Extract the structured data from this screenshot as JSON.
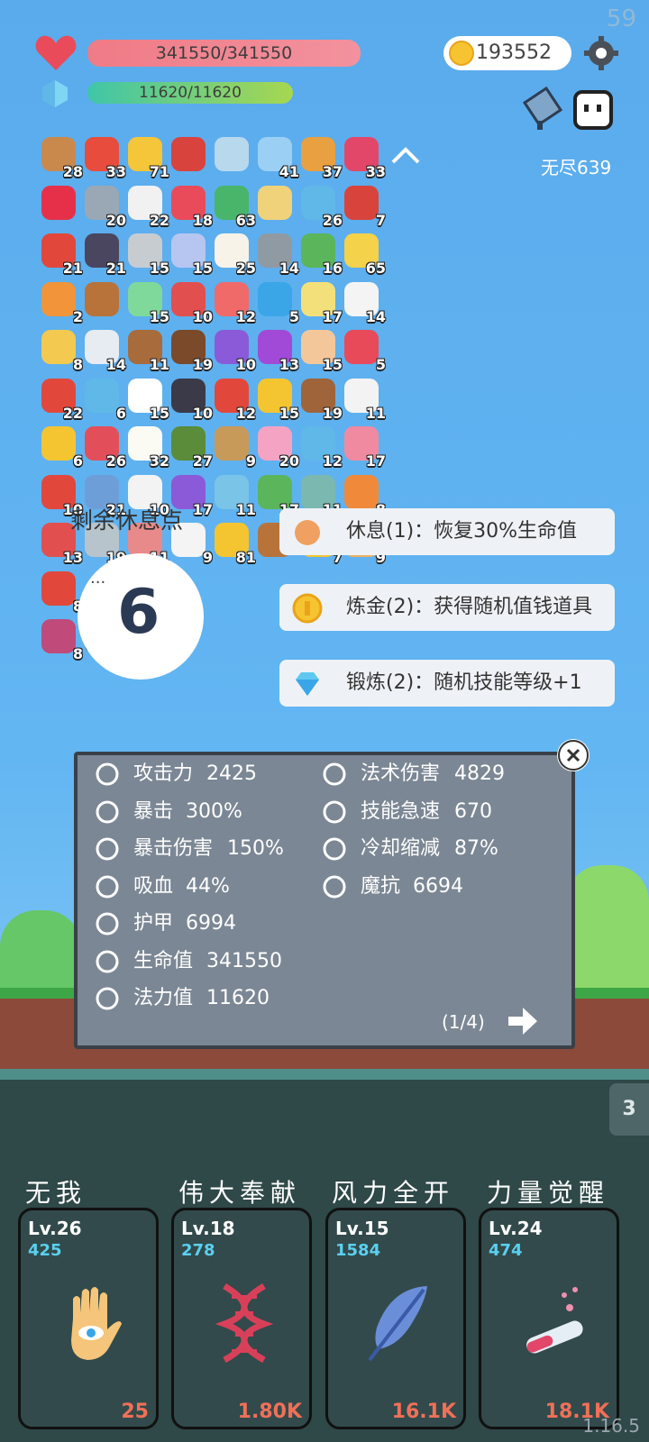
{
  "hud": {
    "fps": "59",
    "hp_text": "341550/341550",
    "mp_text": "11620/11620",
    "coins": "193552",
    "endless_label": "无尽639",
    "version": "1.16.5"
  },
  "items": [
    {
      "icon": "shield-wood-icon",
      "count": "28",
      "color": "#c9894d"
    },
    {
      "icon": "sock-icon",
      "count": "33",
      "color": "#e74c3c"
    },
    {
      "icon": "crown-icon",
      "count": "71",
      "color": "#f5c53a"
    },
    {
      "icon": "magnet-icon",
      "count": "",
      "color": "#d9433d"
    },
    {
      "icon": "magnifier-icon",
      "count": "",
      "color": "#b8d8ee"
    },
    {
      "icon": "star-card-icon",
      "count": "41",
      "color": "#9bd0f4"
    },
    {
      "icon": "book-icon",
      "count": "37",
      "color": "#e8a040"
    },
    {
      "icon": "jam-jar-icon",
      "count": "33",
      "color": "#e2476a"
    },
    {
      "icon": "ruby-icon",
      "count": "",
      "color": "#e6304a"
    },
    {
      "icon": "elephant-icon",
      "count": "20",
      "color": "#9aa8b5"
    },
    {
      "icon": "clipboard-icon",
      "count": "22",
      "color": "#f1f1f1"
    },
    {
      "icon": "heart-icon",
      "count": "18",
      "color": "#e94b5a"
    },
    {
      "icon": "money-icon",
      "count": "63",
      "color": "#48b56a"
    },
    {
      "icon": "map-icon",
      "count": "",
      "color": "#f0d27a"
    },
    {
      "icon": "planet-icon",
      "count": "26",
      "color": "#5fb8e8"
    },
    {
      "icon": "red-shield-icon",
      "count": "7",
      "color": "#d8443c"
    },
    {
      "icon": "mushroom-icon",
      "count": "21",
      "color": "#e2473b"
    },
    {
      "icon": "bat-icon",
      "count": "21",
      "color": "#4a4660"
    },
    {
      "icon": "compass-icon",
      "count": "15",
      "color": "#c7ccd1"
    },
    {
      "icon": "pill-icon",
      "count": "15",
      "color": "#b7c6f0"
    },
    {
      "icon": "egg-icon",
      "count": "25",
      "color": "#f7f3e8"
    },
    {
      "icon": "spiked-ball-icon",
      "count": "14",
      "color": "#8f9aa3"
    },
    {
      "icon": "helmet-icon",
      "count": "16",
      "color": "#5bb55a"
    },
    {
      "icon": "bulb-icon",
      "count": "65",
      "color": "#f4d24a"
    },
    {
      "icon": "torch-icon",
      "count": "2",
      "color": "#f1943a"
    },
    {
      "icon": "chest-icon",
      "count": "",
      "color": "#b7733a"
    },
    {
      "icon": "ghost-green-icon",
      "count": "15",
      "color": "#7fd99a"
    },
    {
      "icon": "potion-icon",
      "count": "10",
      "color": "#e24f4f"
    },
    {
      "icon": "capsule-icon",
      "count": "12",
      "color": "#f06a6a"
    },
    {
      "icon": "sapphire-icon",
      "count": "5",
      "color": "#3aa6e8"
    },
    {
      "icon": "halo-icon",
      "count": "17",
      "color": "#f4e07a"
    },
    {
      "icon": "dice-icon",
      "count": "14",
      "color": "#f4f4f4"
    },
    {
      "icon": "scroll-icon",
      "count": "8",
      "color": "#f3c94f"
    },
    {
      "icon": "envelope-icon",
      "count": "14",
      "color": "#e6ecf2"
    },
    {
      "icon": "flag-icon",
      "count": "11",
      "color": "#a86b3c"
    },
    {
      "icon": "coconut-icon",
      "count": "19",
      "color": "#7a4a2a"
    },
    {
      "icon": "purple-box-icon",
      "count": "10",
      "color": "#8a5ad8"
    },
    {
      "icon": "crystal-ball-icon",
      "count": "13",
      "color": "#a24ad8"
    },
    {
      "icon": "hand-icon",
      "count": "15",
      "color": "#f4c79a"
    },
    {
      "icon": "hearts-icon",
      "count": "5",
      "color": "#e84a5a"
    },
    {
      "icon": "apple-icon",
      "count": "22",
      "color": "#e2473b"
    },
    {
      "icon": "target-icon",
      "count": "6",
      "color": "#5fb8e8"
    },
    {
      "icon": "ghost-icon",
      "count": "15",
      "color": "#ffffff"
    },
    {
      "icon": "cauldron-icon",
      "count": "10",
      "color": "#3a3a48"
    },
    {
      "icon": "strawberry-icon",
      "count": "12",
      "color": "#e2473b"
    },
    {
      "icon": "sunflower-icon",
      "count": "15",
      "color": "#f4c531"
    },
    {
      "icon": "door-icon",
      "count": "19",
      "color": "#a0643a"
    },
    {
      "icon": "cards-icon",
      "count": "11",
      "color": "#f3f3f3"
    },
    {
      "icon": "ring-icon",
      "count": "6",
      "color": "#f4c531"
    },
    {
      "icon": "watermelon-icon",
      "count": "26",
      "color": "#e24f5a"
    },
    {
      "icon": "fried-egg-icon",
      "count": "32",
      "color": "#fbfbf4"
    },
    {
      "icon": "grenade-icon",
      "count": "27",
      "color": "#5a8c3a"
    },
    {
      "icon": "noose-icon",
      "count": "9",
      "color": "#c89a5a"
    },
    {
      "icon": "icecream-icon",
      "count": "20",
      "color": "#f4a3c3"
    },
    {
      "icon": "chat-bubble-icon",
      "count": "12",
      "color": "#5fb8e8"
    },
    {
      "icon": "spray-bottle-icon",
      "count": "17",
      "color": "#f08aa0"
    },
    {
      "icon": "gift-icon",
      "count": "10",
      "color": "#e2473b"
    },
    {
      "icon": "blue-shield-icon",
      "count": "21",
      "color": "#6e9ed8"
    },
    {
      "icon": "half-moon-icon",
      "count": "10",
      "color": "#f3f3f3"
    },
    {
      "icon": "purple-shield-icon",
      "count": "17",
      "color": "#8a5ad8"
    },
    {
      "icon": "blueprint-icon",
      "count": "11",
      "color": "#7ac4e8"
    },
    {
      "icon": "monster-icon",
      "count": "17",
      "color": "#5bb55a"
    },
    {
      "icon": "disc-icon",
      "count": "11",
      "color": "#7ab8b0"
    },
    {
      "icon": "meteor-icon",
      "count": "8",
      "color": "#f08a3a"
    },
    {
      "icon": "thermometer-icon",
      "count": "13",
      "color": "#e24f4f"
    },
    {
      "icon": "sword-icon",
      "count": "19",
      "color": "#b8c4cc"
    },
    {
      "icon": "meat-icon",
      "count": "11",
      "color": "#e88a8a"
    },
    {
      "icon": "lightbulb-icon",
      "count": "9",
      "color": "#f4f4f4"
    },
    {
      "icon": "gold-stack-icon",
      "count": "81",
      "color": "#f4c531"
    },
    {
      "icon": "bow-icon",
      "count": "",
      "color": "#b8733a"
    },
    {
      "icon": "magic-wand-icon",
      "count": "7",
      "color": "#f4c531"
    },
    {
      "icon": "parchment-icon",
      "count": "9",
      "color": "#f0b060"
    },
    {
      "icon": "red-flag-icon",
      "count": "8",
      "color": "#e2473b"
    },
    {
      "icon": "striped-box-icon",
      "count": "8",
      "color": "#c04a7a"
    },
    {
      "icon": "idea-tile-icon",
      "count": "",
      "color": "#2f5f6f"
    }
  ],
  "rest": {
    "label": "剩余休息点",
    "count": "6",
    "dots": "···"
  },
  "options": [
    {
      "icon": "heal-icon",
      "text": "休息(1)：恢复30%生命值",
      "color": "#f0a060"
    },
    {
      "icon": "coin-icon",
      "text": "炼金(2)：获得随机值钱道具",
      "color": "#f7c431"
    },
    {
      "icon": "diamond-icon",
      "text": "锻炼(2)：随机技能等级+1",
      "color": "#5fc8f0"
    }
  ],
  "stats": {
    "left": [
      {
        "icon": "axe-icon",
        "label": "攻击力",
        "value": "2425"
      },
      {
        "icon": "crit-icon",
        "label": "暴击",
        "value": "300%"
      },
      {
        "icon": "crit-damage-icon",
        "label": "暴击伤害",
        "value": "150%"
      },
      {
        "icon": "lifesteal-icon",
        "label": "吸血",
        "value": "44%"
      },
      {
        "icon": "armor-icon",
        "label": "护甲",
        "value": "6994"
      },
      {
        "icon": "health-icon",
        "label": "生命值",
        "value": "341550"
      },
      {
        "icon": "mana-icon",
        "label": "法力值",
        "value": "11620"
      }
    ],
    "right": [
      {
        "icon": "spell-damage-icon",
        "label": "法术伤害",
        "value": "4829"
      },
      {
        "icon": "haste-icon",
        "label": "技能急速",
        "value": "670"
      },
      {
        "icon": "hourglass-icon",
        "label": "冷却缩减",
        "value": "87%"
      },
      {
        "icon": "magic-resist-icon",
        "label": "魔抗",
        "value": "6694"
      }
    ],
    "page": "(1/4)"
  },
  "side_tab": "3",
  "skills": [
    {
      "name": "无我",
      "level": "Lv.26",
      "value": "425",
      "cost": "25",
      "icon": "eye-hand-icon"
    },
    {
      "name": "伟大奉献",
      "level": "Lv.18",
      "value": "278",
      "cost": "1.80K",
      "icon": "dna-icon"
    },
    {
      "name": "风力全开",
      "level": "Lv.15",
      "value": "1584",
      "cost": "16.1K",
      "icon": "feather-icon"
    },
    {
      "name": "力量觉醒",
      "level": "Lv.24",
      "value": "474",
      "cost": "18.1K",
      "icon": "test-tube-icon"
    }
  ]
}
